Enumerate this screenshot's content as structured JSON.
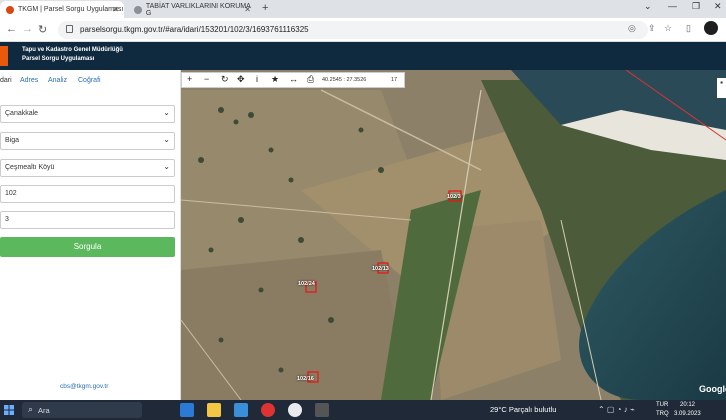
{
  "browser": {
    "tabs": [
      {
        "title": "TKGM | Parsel Sorgu Uygulaması",
        "active": true
      },
      {
        "title": "TABİAT VARLIKLARINI KORUMA G",
        "active": false
      }
    ],
    "url": "parselsorgu.tkgm.gov.tr/#ara/idari/153201/102/3/1693761116325"
  },
  "header": {
    "line1": "Tapu ve Kadastro Genel Müdürlüğü",
    "line2": "Parsel Sorgu Uygulaması"
  },
  "sidebar": {
    "tabs": [
      "dari",
      "Adres",
      "Analiz",
      "Coğrafi"
    ],
    "il": "Çanakkale",
    "ilce": "Biga",
    "mahalle": "Çeşmealtı Köyü",
    "ada": "102",
    "parsel": "3",
    "submit_label": "Sorgula",
    "email": "cbs@tkgm.gov.tr"
  },
  "map": {
    "coords": "40.2545 : 27.3526",
    "zoom": "17",
    "parcel_labels": [
      "102/3",
      "102/13",
      "102/24",
      "102/16"
    ],
    "attribution": "Google"
  },
  "taskbar": {
    "search": "Ara",
    "weather": "29°C  Parçalı bulutlu",
    "lang1": "TUR",
    "lang2": "TRQ",
    "time": "20:12",
    "date": "3.09.2023"
  }
}
